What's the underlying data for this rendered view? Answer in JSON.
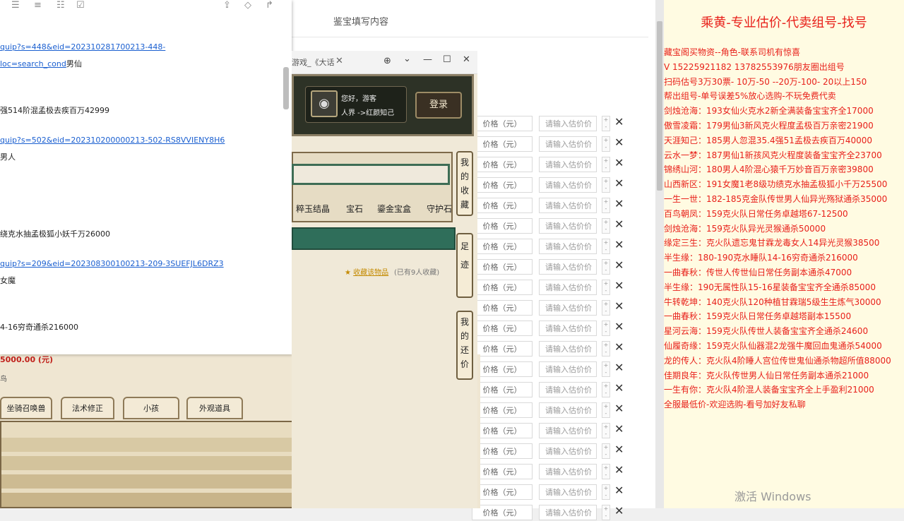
{
  "form": {
    "title": "鉴宝填写内容",
    "price_label": "价格（元）",
    "price_placeholder": "请输入估价价",
    "rows": 20
  },
  "notes": {
    "lines": [
      {
        "text": "quip?s=448&eid=202310281700213-448-",
        "link": true
      },
      {
        "text": "loc=search_cond",
        "link": true,
        "suffix": "男仙"
      },
      {
        "text": "强514阶混孟极去疾百万42999",
        "link": false
      },
      {
        "text": "quip?s=502&eid=202310200000213-502-RS8VVIENY8H6",
        "link": true
      },
      {
        "text": "男人",
        "link": false
      },
      {
        "text": "绕克水抽孟极狐小妖千万26000",
        "link": false
      },
      {
        "text": "quip?s=209&eid=202308300100213-209-3SUEFJL6DRZ3",
        "link": true
      },
      {
        "text": "女魔",
        "link": false
      },
      {
        "text": "4-16穷奇通杀216000",
        "link": false
      }
    ]
  },
  "game": {
    "price": "5000.00 (元)",
    "price_sub": "鸟",
    "tabs": [
      "坐骑召唤兽",
      "法术修正",
      "小孩",
      "外观道具"
    ],
    "popup_tab": "游戏_《大话",
    "hello": "您好，游客",
    "realm": "人界 ->红颜知己",
    "login": "登录",
    "categories": [
      "粹玉结晶",
      "宝石",
      "鎏金宝盒",
      "守护石"
    ],
    "fav_link": "收藏该物品",
    "fav_count": "(已有9人收藏)",
    "side_tabs": [
      "我的收藏",
      "足迹",
      "我的还价"
    ]
  },
  "promo": {
    "title": "乘黄-专业估价-代卖组号-找号",
    "lines": [
      "藏宝阁买物资--角色-联系司机有惊喜",
      "V 15225921182   13782553976朋友圈出组号",
      "扫码估号3万30票- 10万-50 --20万-100- 20以上150",
      "帮出组号-单号误差5%放心选购-不玩免费代卖",
      "剑烛沧海：193女仙火克水2新全满装备宝宝齐全17000",
      "傲雪凌霜：179男仙3新风克火程度孟极百万亲密21900",
      "天涯知己：185男人忽混35.4强51孟极去疾百万40000",
      "云水一梦：187男仙1新孩风克火程度装备宝宝齐全23700",
      "锦绣山河：180男人4阶混心猿千万妙音百万亲密39800",
      "山西新区：191女魔1老8级功绩克水抽孟极狐小千万25500",
      "一生一世：182-185克金队传世男人仙异光殇狱通杀35000",
      "百鸟朝凤：159克火队日常任务卓越塔67-12500",
      "剑烛沧海：159克火队异光灵猴通杀50000",
      "缘定三生：克火队遗忘鬼甘霖龙毒女人14异光灵猴38500",
      "半生缘：180-190克水睡队14-16穷奇通杀216000",
      "一曲春秋：传世人传世仙日常任务副本通杀47000",
      "半生缘：190无属性队15-16星装备宝宝齐全通杀85000",
      "牛转乾坤：140克火队120种植甘霖瑞5级生生炼气30000",
      "一曲春秋：159克火队日常任务卓越塔副本15500",
      "星河云海：159克火队传世人装备宝宝齐全通杀24600",
      "仙履奇缘：159克火队仙器混2龙强牛魔回血鬼通杀54000",
      "龙的传人：克火队4阶睡人宫位传世鬼仙通杀物超所值88000",
      "佳期良年：克火队传世男人仙日常任务副本通杀21000",
      "一生有你：克火队4阶混人装备宝宝齐全上手盈利21000",
      "全服最低价-欢迎选购-看号加好友私聊"
    ]
  },
  "watermark": "激活 Windows",
  "colors": {
    "promo_red": "#e8201a",
    "link_blue": "#1a5fd0",
    "game_green": "#2f6e5a"
  }
}
